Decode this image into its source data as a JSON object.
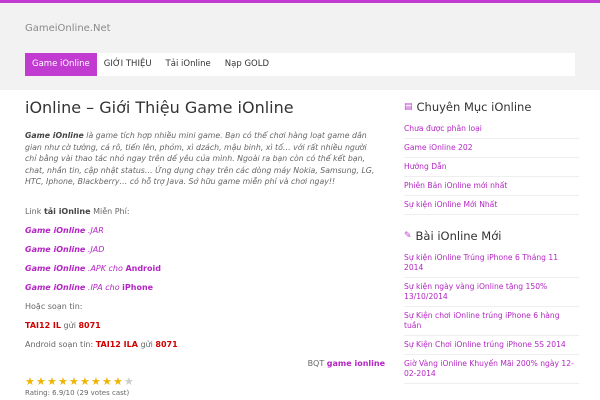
{
  "site": {
    "title": "GameiOnline.Net"
  },
  "nav": {
    "items": [
      "Game iOnline",
      "GIỚI THIỆU",
      "Tải iOnline",
      "Nạp GOLD"
    ]
  },
  "post": {
    "title": "iOnline – Giới Thiệu Game iOnline",
    "intro_bold": "Game iOnline",
    "intro_text": " là game tích hợp nhiều mini game. Bạn có thể chơi hàng loạt game dân gian như cờ tướng, cá rô, tiến lên, phỏm, xì dzách, mậu binh, xì tố… với rất nhiều người chỉ bằng vài thao tác nhỏ ngay trên dế yêu của mình. Ngoài ra bạn còn có thể kết bạn, chat, nhắn tin, cập nhật status… Ứng dụng chạy trên các dòng máy Nokia, Samsung, LG, HTC, Iphone, Blackberry… có hỗ trợ Java. Sở hữu game miễn phí và chơi ngay!!",
    "link_prefix": "Link ",
    "link_bold": "tải iOnline",
    "link_suffix": " Miễn Phí:",
    "links": [
      {
        "name": "Game iOnline",
        "suffix": " .JAR",
        "extra": ""
      },
      {
        "name": "Game iOnline",
        "suffix": " .JAD",
        "extra": ""
      },
      {
        "name": "Game iOnline",
        "suffix": " .APK cho ",
        "extra": "Android"
      },
      {
        "name": "Game iOnline",
        "suffix": " .IPA cho ",
        "extra": "iPhone"
      }
    ],
    "sms_label": "Hoặc soạn tin:",
    "sms1_code": "TAI12 IL",
    "sms_send": " gửi ",
    "sms1_number": "8071",
    "android_label": "Android soạn tin: ",
    "sms2_code": "TAI12 ILA",
    "sms2_number": "8071",
    "byline_prefix": "BQT ",
    "byline_name": "game ionline",
    "rating_stars": 9,
    "rating_text": "Rating: 6.9/10 (29 votes cast)"
  },
  "sidebar": {
    "categories_title": "Chuyên Mục iOnline",
    "categories": [
      "Chưa được phân loại",
      "Game iOnline 202",
      "Hướng Dẫn",
      "Phiên Bản iOnline mới nhất",
      "Sự kiện iOnline Mới Nhất"
    ],
    "recent_title": "Bài iOnline Mới",
    "recent": [
      "Sự kiện iOnline Trúng iPhone 6 Tháng 11 2014",
      "Sự kiện ngày vàng iOnline tặng 150% 13/10/2014",
      "Sự Kiện chơi iOnline trúng iPhone 6 hàng tuần",
      "Sự Kiện Chơi iOnline trúng iPhone 5S 2014",
      "Giờ Vàng iOnline Khuyến Mãi 200% ngày 12-02-2014"
    ]
  },
  "colors": {
    "accent": "#c13bd1",
    "link": "#b426c4",
    "sms": "#d00000",
    "star": "#f0b400"
  },
  "icons": {
    "widget": "list-icon",
    "widget2": "pencil-icon",
    "star": "star-icon"
  }
}
